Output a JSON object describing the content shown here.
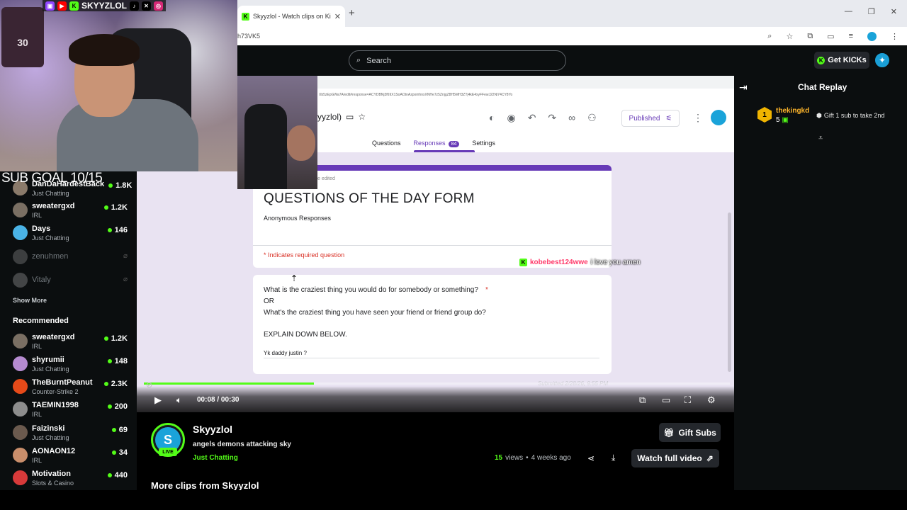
{
  "browser": {
    "tab_title": "Skyyzlol - Watch clips on Kick",
    "address": "h73VK5",
    "favicon_letter": "K"
  },
  "header": {
    "search_placeholder": "Search",
    "get_kicks_label": "Get KICKs"
  },
  "overlay": {
    "channel_handle": "SKYYZLOL",
    "sub_goal": "SUB GOAL 10/15",
    "jersey_number": "30"
  },
  "sidebar": {
    "following": [
      {
        "name": "DanDaHardestBack",
        "category": "Just Chatting",
        "viewers": "1.8K",
        "color": "#8a7a6a",
        "live": true
      },
      {
        "name": "sweatergxd",
        "category": "IRL",
        "viewers": "1.2K",
        "color": "#7a6f63",
        "live": true
      },
      {
        "name": "Days",
        "category": "Just Chatting",
        "viewers": "146",
        "color": "#4ab3e6",
        "live": true
      },
      {
        "name": "zenuhmen",
        "category": "",
        "viewers": "",
        "color": "#888888",
        "live": false
      },
      {
        "name": "Vitaly",
        "category": "",
        "viewers": "",
        "color": "#999999",
        "live": false
      }
    ],
    "show_more": "Show More",
    "recommended_heading": "Recommended",
    "recommended": [
      {
        "name": "sweatergxd",
        "category": "IRL",
        "viewers": "1.2K",
        "color": "#7a6f63"
      },
      {
        "name": "shyrumii",
        "category": "Just Chatting",
        "viewers": "148",
        "color": "#b58bd0"
      },
      {
        "name": "TheBurntPeanut",
        "category": "Counter-Strike 2",
        "viewers": "2.3K",
        "color": "#e64a19"
      },
      {
        "name": "TAEMIN1998",
        "category": "IRL",
        "viewers": "200",
        "color": "#8d8d8d"
      },
      {
        "name": "Faizinski",
        "category": "Just Chatting",
        "viewers": "69",
        "color": "#6b5a4e"
      },
      {
        "name": "AONAON12",
        "category": "IRL",
        "viewers": "34",
        "color": "#c98e6b"
      },
      {
        "name": "Motivation",
        "category": "Slots & Casino",
        "viewers": "440",
        "color": "#d83a3a"
      }
    ]
  },
  "form": {
    "url_text": "Xb5zEpGWa7A/edit#response=ACYDBNj3f69X1SoAOtnAzpomhnxXNHe7z5ZnjgZ8H5MH3ZTj4kE4xyFFewJ22Nl74CY8Yo",
    "doc_name": "yyzlol)",
    "published_label": "Published",
    "tabs": [
      "Questions",
      "Responses",
      "Settings"
    ],
    "responses_count": "84",
    "edited_note": "e edited",
    "title": "QUESTIONS OF THE DAY FORM",
    "description": "Anonymous Responses",
    "required_note": "* Indicates required question",
    "question_lines": [
      "What is the craziest thing you would do for somebody or something?",
      "OR",
      "What's the craziest thing you have seen your friend or friend group do?",
      "",
      "EXPLAIN DOWN BELOW."
    ],
    "required_star": "*",
    "answer": "Yk daddy justin ?",
    "submitted": "Submitted 2/28/26, 9:55 PM"
  },
  "stream_chat_overlay": {
    "user": "kobebest124wwe",
    "message": "i love you amen"
  },
  "player": {
    "time": "00:08 / 00:30",
    "progress": 0.29
  },
  "chat": {
    "title": "Chat Replay",
    "gift_user": "thekingkd",
    "gift_rank": "1",
    "gift_count": "5",
    "gift_message": "Gift 1 sub to take 2nd"
  },
  "channel": {
    "name": "Skyyzlol",
    "clip_title": "angels demons attacking sky",
    "category": "Just Chatting",
    "live_label": "LIVE",
    "gift_subs_label": "Gift Subs",
    "views_count": "15",
    "views_word": "views",
    "separator": "•",
    "age": "4 weeks ago",
    "watch_full_label": "Watch full video",
    "more_clips": "More clips from Skyyzlol"
  },
  "colors": {
    "kick_green": "#53fc18",
    "forms_purple": "#673ab7",
    "background": "#0b0e0f"
  }
}
